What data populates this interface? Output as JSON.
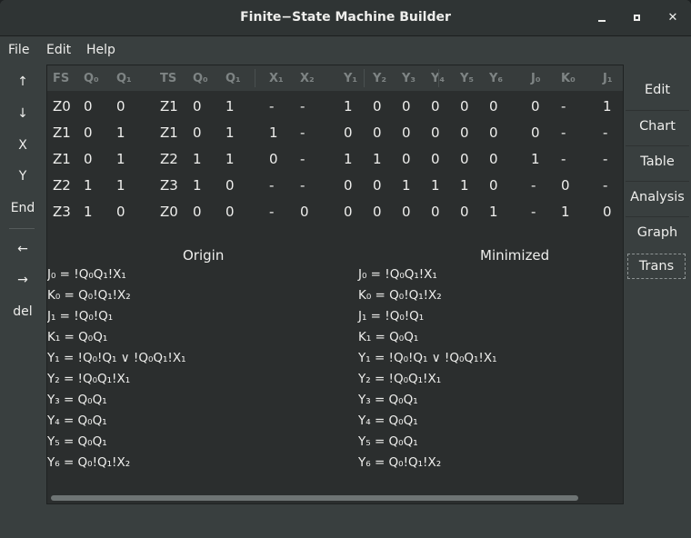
{
  "window": {
    "title": "Finite−State Machine Builder"
  },
  "window_controls": [
    "minimize",
    "maximize",
    "close"
  ],
  "menubar": {
    "file": "File",
    "edit": "Edit",
    "help": "Help"
  },
  "toolbar": {
    "up": "↑",
    "down": "↓",
    "x": "X",
    "y": "Y",
    "end": "End",
    "left": "←",
    "right": "→",
    "del": "del"
  },
  "sidebar": {
    "items": [
      "Edit",
      "Chart",
      "Table",
      "Analysis",
      "Graph",
      "Trans"
    ],
    "active": "Trans"
  },
  "table": {
    "headers": [
      "FS",
      "Q₀",
      "Q₁",
      "TS",
      "Q₀",
      "Q₁",
      "X₁",
      "X₂",
      "Y₁",
      "Y₂",
      "Y₃",
      "Y₄",
      "Y₅",
      "Y₆",
      "J₀",
      "K₀",
      "J₁"
    ],
    "rows": [
      [
        "Z0",
        "0",
        "0",
        "Z1",
        "0",
        "1",
        "-",
        "-",
        "1",
        "0",
        "0",
        "0",
        "0",
        "0",
        "0",
        "-",
        "1"
      ],
      [
        "Z1",
        "0",
        "1",
        "Z1",
        "0",
        "1",
        "1",
        "-",
        "0",
        "0",
        "0",
        "0",
        "0",
        "0",
        "0",
        "-",
        "-"
      ],
      [
        "Z1",
        "0",
        "1",
        "Z2",
        "1",
        "1",
        "0",
        "-",
        "1",
        "1",
        "0",
        "0",
        "0",
        "0",
        "1",
        "-",
        "-"
      ],
      [
        "Z2",
        "1",
        "1",
        "Z3",
        "1",
        "0",
        "-",
        "-",
        "0",
        "0",
        "1",
        "1",
        "1",
        "0",
        "-",
        "0",
        "-"
      ],
      [
        "Z3",
        "1",
        "0",
        "Z0",
        "0",
        "0",
        "-",
        "0",
        "0",
        "0",
        "0",
        "0",
        "0",
        "1",
        "-",
        "1",
        "0"
      ]
    ]
  },
  "origin": {
    "title": "Origin",
    "equations": [
      "J₀ = !Q₀Q₁!X₁",
      "K₀ = Q₀!Q₁!X₂",
      "J₁ = !Q₀!Q₁",
      "K₁ = Q₀Q₁",
      "Y₁ = !Q₀!Q₁ ∨ !Q₀Q₁!X₁",
      "Y₂ = !Q₀Q₁!X₁",
      "Y₃ = Q₀Q₁",
      "Y₄ = Q₀Q₁",
      "Y₅ = Q₀Q₁",
      "Y₆ = Q₀!Q₁!X₂"
    ]
  },
  "minimized": {
    "title": "Minimized",
    "equations": [
      "J₀ = !Q₀Q₁!X₁",
      "K₀ = Q₀!Q₁!X₂",
      "J₁ = !Q₀!Q₁",
      "K₁ = Q₀Q₁",
      "Y₁ = !Q₀!Q₁ ∨ !Q₀Q₁!X₁",
      "Y₂ = !Q₀Q₁!X₁",
      "Y₃ = Q₀Q₁",
      "Y₄ = Q₀Q₁",
      "Y₅ = Q₀Q₁",
      "Y₆ = Q₀!Q₁!X₂"
    ]
  },
  "colors": {
    "window_bg": "#393f3f",
    "panel_bg": "#2b2e2e",
    "header_text": "#7e8484",
    "text": "#eeeeec"
  }
}
